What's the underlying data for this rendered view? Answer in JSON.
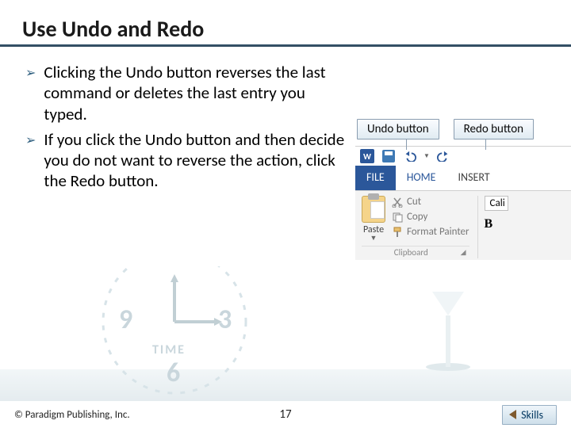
{
  "title": "Use Undo and Redo",
  "bullets": [
    "Clicking the Undo button reverses the last command or deletes the last entry you typed.",
    "If you click the Undo button and then decide you do not want to reverse the action, click the Redo button."
  ],
  "callouts": {
    "undo": "Undo button",
    "redo": "Redo button"
  },
  "ribbon": {
    "tabs": {
      "file": "FILE",
      "home": "HOME",
      "insert": "INSERT"
    },
    "paste": "Paste",
    "cut": "Cut",
    "copy": "Copy",
    "format_painter": "Format Painter",
    "clipboard_group": "Clipboard",
    "font_name": "Cali",
    "bold": "B"
  },
  "footer": {
    "copyright": "© Paradigm Publishing, Inc.",
    "page": "17",
    "skills": "Skills"
  },
  "deco": {
    "nine": "9",
    "three": "3",
    "six": "6",
    "time": "TIME"
  }
}
